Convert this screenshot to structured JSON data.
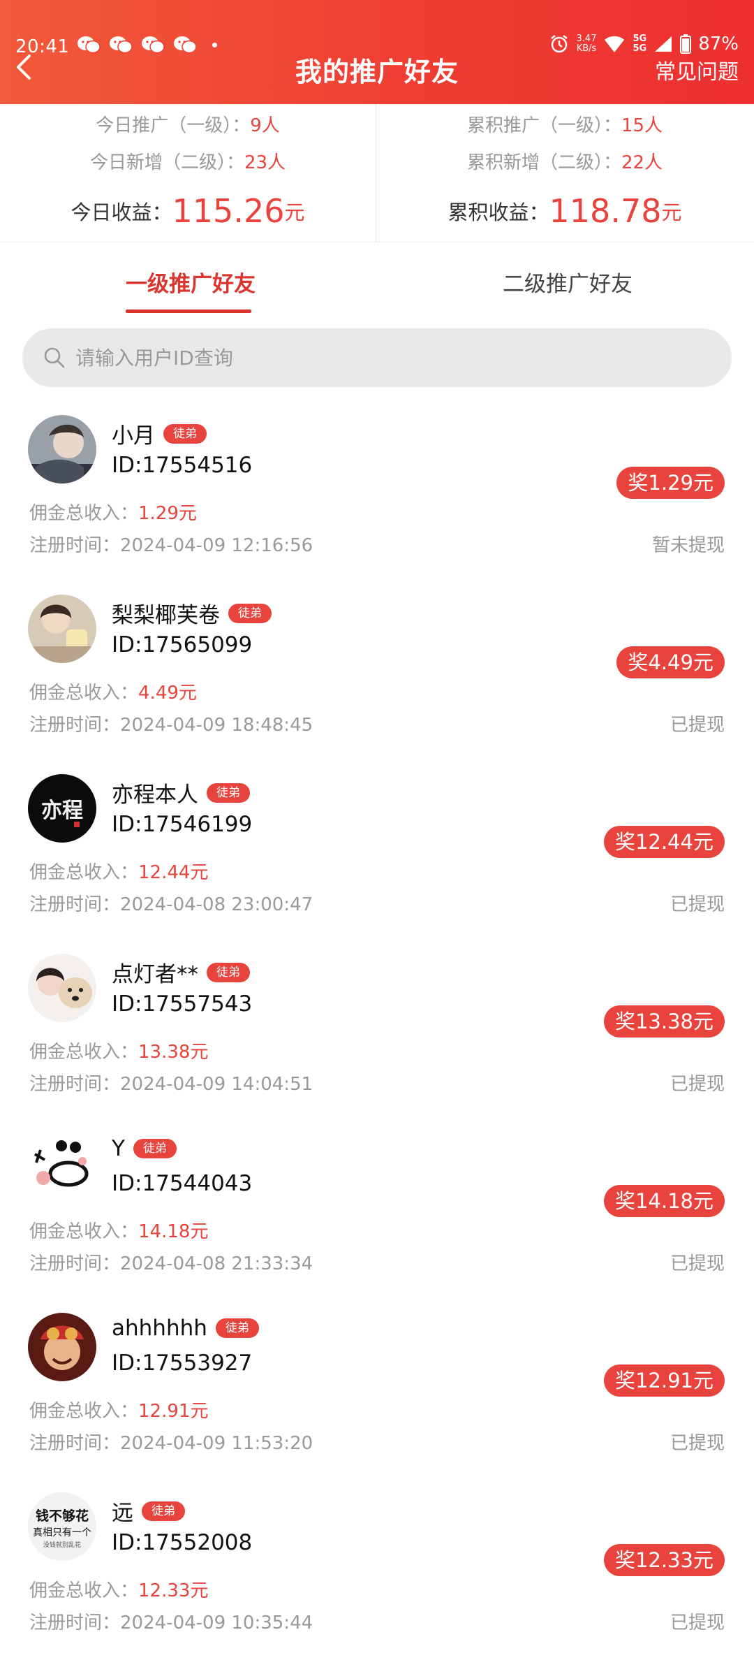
{
  "status_bar": {
    "time": "20:41",
    "speed_value": "3.47",
    "speed_unit": "KB/s",
    "network_top": "5G",
    "network_bottom": "5G",
    "battery": "87%"
  },
  "header": {
    "title": "我的推广好友",
    "faq_label": "常见问题",
    "background_color": "#ef3d33"
  },
  "stats": {
    "today_promo_label": "今日推广（一级）：",
    "today_promo_value": "9人",
    "today_new_label": "今日新增（二级）：",
    "today_new_value": "23人",
    "total_promo_label": "累积推广（一级）：",
    "total_promo_value": "15人",
    "total_new_label": "累积新增（二级）：",
    "total_new_value": "22人",
    "today_income_label": "今日收益：",
    "today_income_value": "115.26",
    "total_income_label": "累积收益：",
    "total_income_value": "118.78",
    "unit": "元"
  },
  "tabs": [
    {
      "label": "一级推广好友",
      "active": true
    },
    {
      "label": "二级推广好友",
      "active": false
    }
  ],
  "search": {
    "placeholder": "请输入用户ID查询"
  },
  "labels": {
    "commission": "佣金总收入：",
    "register_time": "注册时间：",
    "badge": "徒弟"
  },
  "friends": [
    {
      "name": "小月",
      "id": "ID:17554516",
      "commission": "1.29元",
      "register_time": "2024-04-09 12:16:56",
      "reward": "奖1.29元",
      "status": "暂未提现"
    },
    {
      "name": "梨梨椰芙卷",
      "id": "ID:17565099",
      "commission": "4.49元",
      "register_time": "2024-04-09 18:48:45",
      "reward": "奖4.49元",
      "status": "已提现"
    },
    {
      "name": "亦程本人",
      "id": "ID:17546199",
      "commission": "12.44元",
      "register_time": "2024-04-08 23:00:47",
      "reward": "奖12.44元",
      "status": "已提现"
    },
    {
      "name": "点灯者**",
      "id": "ID:17557543",
      "commission": "13.38元",
      "register_time": "2024-04-09 14:04:51",
      "reward": "奖13.38元",
      "status": "已提现"
    },
    {
      "name": "Y",
      "id": "ID:17544043",
      "commission": "14.18元",
      "register_time": "2024-04-08 21:33:34",
      "reward": "奖14.18元",
      "status": "已提现"
    },
    {
      "name": "ahhhhhh",
      "id": "ID:17553927",
      "commission": "12.91元",
      "register_time": "2024-04-09 11:53:20",
      "reward": "奖12.91元",
      "status": "已提现"
    },
    {
      "name": "远",
      "id": "ID:17552008",
      "commission": "12.33元",
      "register_time": "2024-04-09 10:35:44",
      "reward": "奖12.33元",
      "status": "已提现"
    }
  ],
  "avatar_texts": {
    "yicheng": "亦程",
    "yuan_line1": "钱不够花",
    "yuan_line2": "真相只有一个",
    "yuan_line3": "没钱就别乱花"
  }
}
